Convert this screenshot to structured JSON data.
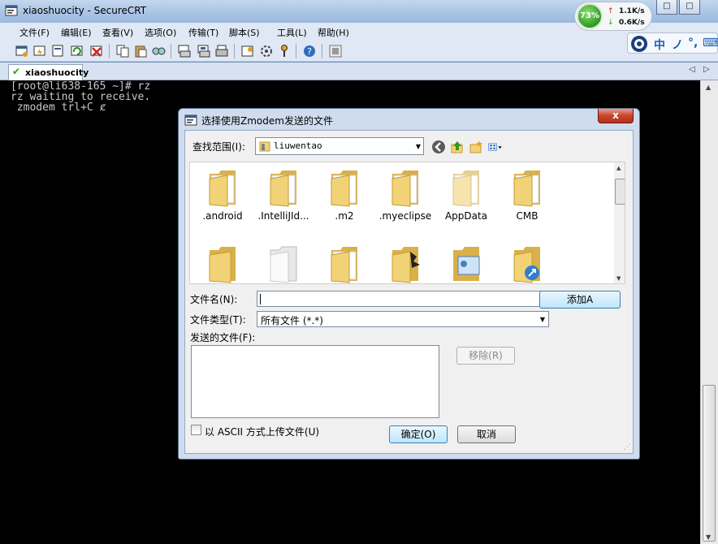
{
  "window": {
    "title": "xiaoshuocity - SecureCRT",
    "minimize": "□",
    "maximize": "□",
    "close": "X"
  },
  "menu": [
    {
      "label": "文件(F)"
    },
    {
      "label": "编辑(E)"
    },
    {
      "label": "查看(V)"
    },
    {
      "label": "选项(O)"
    },
    {
      "label": "传输(T)"
    },
    {
      "label": "脚本(S)"
    },
    {
      "label": "工具(L)"
    },
    {
      "label": "帮助(H)"
    }
  ],
  "tab": {
    "label": "xiaoshuocity",
    "prev": "◁",
    "next": "▷"
  },
  "terminal": {
    "lines": [
      "[root@li638-165 ~]# rz",
      "rz waiting to receive.",
      " zmodem trl+C ȼ"
    ]
  },
  "netmon": {
    "percent": "73%",
    "up_arrow": "↑",
    "down_arrow": "↓",
    "up": "1.1K/s",
    "down": "0.6K/s"
  },
  "ime": {
    "g1": "中",
    "g2": "ノ",
    "g3": "°,",
    "g4": "⌨"
  },
  "dialog": {
    "title": "选择使用Zmodem发送的文件",
    "close": "x",
    "lookin_label": "查找范围(I):",
    "lookin_value": "liuwentao",
    "files": [
      {
        "name": ".android"
      },
      {
        "name": ".IntelliJId..."
      },
      {
        "name": ".m2"
      },
      {
        "name": ".myeclipse"
      },
      {
        "name": "AppData"
      },
      {
        "name": "CMB"
      }
    ],
    "filename_label": "文件名(N):",
    "filename_value": "",
    "filetype_label": "文件类型(T):",
    "filetype_value": "所有文件 (*.*)",
    "add_button": "添加A",
    "sent_label": "发送的文件(F):",
    "remove_button": "移除(R)",
    "ascii_label": "以 ASCII 方式上传文件(U)",
    "ok_button": "确定(O)",
    "cancel_button": "取消"
  },
  "colors": {
    "folder": "#f2d277",
    "folder_dark": "#d9b04a",
    "accent": "#3c7fb1"
  }
}
